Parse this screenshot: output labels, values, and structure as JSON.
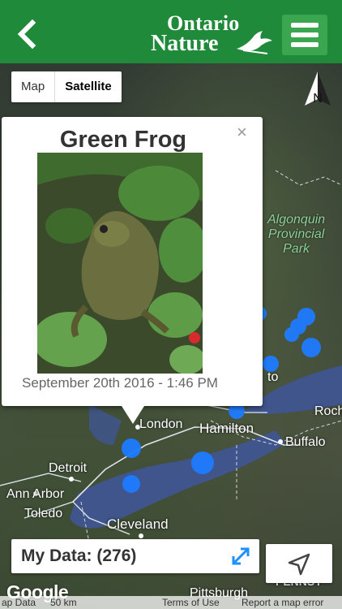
{
  "header": {
    "back_icon": "chevron-left-icon",
    "logo_line1": "Ontario",
    "logo_line2": "Nature",
    "menu_icon": "hamburger-menu-icon",
    "color": "#1f8a3a"
  },
  "map_type": {
    "options": [
      "Map",
      "Satellite"
    ],
    "selected": "Satellite"
  },
  "compass": {
    "label": "N"
  },
  "map_labels": {
    "park_line1": "Algonquin",
    "park_line2": "Provincial",
    "park_line3": "Park",
    "london": "London",
    "hamilton": "Hamilton",
    "buffalo": "Buffalo",
    "detroit": "Detroit",
    "ann_arbor": "Ann Arbor",
    "toledo": "Toledo",
    "cleveland": "Cleveland",
    "pittsburgh": "Pittsburgh",
    "rochester_partial": "Roch",
    "toronto_partial": "to",
    "penn_partial": "PENNSY"
  },
  "popup": {
    "title": "Green Frog",
    "close": "×",
    "date": "September 20th 2016 - 1:46 PM"
  },
  "my_data": {
    "label": "My Data: (276)",
    "expand_icon": "expand-icon"
  },
  "locate": {
    "icon": "navigation-arrow-icon"
  },
  "google": "Google",
  "attribution": {
    "map_data": "ap Data",
    "scale": "50 km",
    "terms": "Terms of Use",
    "report": "Report a map error"
  },
  "marker_color": "#1e7bff"
}
